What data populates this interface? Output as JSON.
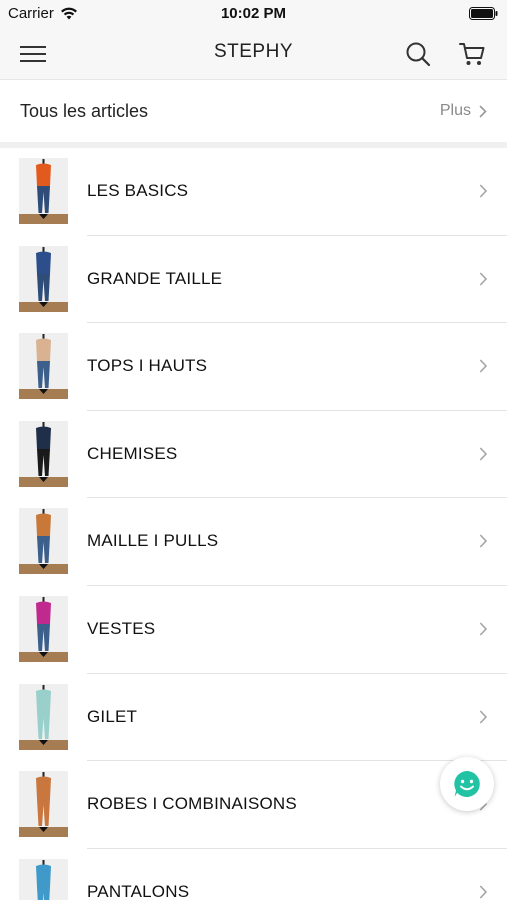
{
  "status": {
    "carrier": "Carrier",
    "time": "10:02 PM"
  },
  "nav": {
    "title": "STEPHY"
  },
  "all_articles": {
    "label": "Tous les articles",
    "more": "Plus"
  },
  "categories": [
    {
      "label": "LES BASICS",
      "top": "#e35a1e",
      "bottom": "#2f4d78"
    },
    {
      "label": "GRANDE TAILLE",
      "top": "#2c4e8a",
      "bottom": "#2f4d78"
    },
    {
      "label": "TOPS I HAUTS",
      "top": "#d9b391",
      "bottom": "#3c5f8c"
    },
    {
      "label": "CHEMISES",
      "top": "#1f2f4a",
      "bottom": "#1a1a1a"
    },
    {
      "label": "MAILLE I PULLS",
      "top": "#c87838",
      "bottom": "#3c5f8c"
    },
    {
      "label": "VESTES",
      "top": "#c02a8f",
      "bottom": "#3c5f8c"
    },
    {
      "label": "GILET",
      "top": "#9ad0cc",
      "bottom": "#9ad0cc"
    },
    {
      "label": "ROBES I COMBINAISONS",
      "top": "#c9773e",
      "bottom": "#c9773e"
    },
    {
      "label": "PANTALONS",
      "top": "#3f9ac9",
      "bottom": "#3f9ac9"
    }
  ],
  "colors": {
    "chat_accent": "#22c3a5",
    "divider": "#e3e3e3"
  }
}
